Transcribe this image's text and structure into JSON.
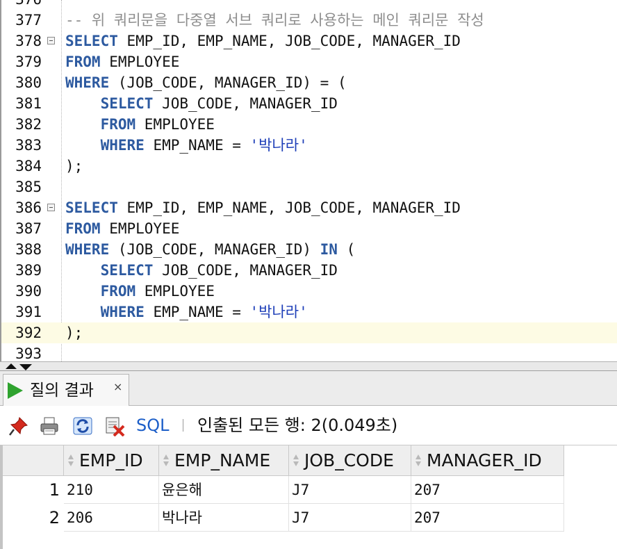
{
  "editor": {
    "lines": [
      {
        "num": "376",
        "segments": []
      },
      {
        "num": "377",
        "segments": [
          {
            "t": "-- 위 쿼리문을 다중열 서브 쿼리로 사용하는 메인 쿼리문 작성",
            "c": "cmt"
          }
        ]
      },
      {
        "num": "378",
        "fold": true,
        "segments": [
          {
            "t": "SELECT",
            "c": "kw"
          },
          {
            "t": " EMP_ID, EMP_NAME, JOB_CODE, MANAGER_ID",
            "c": ""
          }
        ]
      },
      {
        "num": "379",
        "segments": [
          {
            "t": "FROM",
            "c": "kw"
          },
          {
            "t": " EMPLOYEE",
            "c": ""
          }
        ]
      },
      {
        "num": "380",
        "segments": [
          {
            "t": "WHERE",
            "c": "kw"
          },
          {
            "t": " (JOB_CODE, MANAGER_ID) = (",
            "c": ""
          }
        ]
      },
      {
        "num": "381",
        "segments": [
          {
            "t": "    ",
            "c": ""
          },
          {
            "t": "SELECT",
            "c": "kw"
          },
          {
            "t": " JOB_CODE, MANAGER_ID",
            "c": ""
          }
        ]
      },
      {
        "num": "382",
        "segments": [
          {
            "t": "    ",
            "c": ""
          },
          {
            "t": "FROM",
            "c": "kw"
          },
          {
            "t": " EMPLOYEE",
            "c": ""
          }
        ]
      },
      {
        "num": "383",
        "segments": [
          {
            "t": "    ",
            "c": ""
          },
          {
            "t": "WHERE",
            "c": "kw"
          },
          {
            "t": " EMP_NAME = ",
            "c": ""
          },
          {
            "t": "'박나라'",
            "c": "str"
          }
        ]
      },
      {
        "num": "384",
        "segments": [
          {
            "t": ");",
            "c": ""
          }
        ]
      },
      {
        "num": "385",
        "segments": []
      },
      {
        "num": "386",
        "fold": true,
        "segments": [
          {
            "t": "SELECT",
            "c": "kw"
          },
          {
            "t": " EMP_ID, EMP_NAME, JOB_CODE, MANAGER_ID",
            "c": ""
          }
        ]
      },
      {
        "num": "387",
        "segments": [
          {
            "t": "FROM",
            "c": "kw"
          },
          {
            "t": " EMPLOYEE",
            "c": ""
          }
        ]
      },
      {
        "num": "388",
        "segments": [
          {
            "t": "WHERE",
            "c": "kw"
          },
          {
            "t": " (JOB_CODE, MANAGER_ID) ",
            "c": ""
          },
          {
            "t": "IN",
            "c": "kw"
          },
          {
            "t": " (",
            "c": ""
          }
        ]
      },
      {
        "num": "389",
        "segments": [
          {
            "t": "    ",
            "c": ""
          },
          {
            "t": "SELECT",
            "c": "kw"
          },
          {
            "t": " JOB_CODE, MANAGER_ID",
            "c": ""
          }
        ]
      },
      {
        "num": "390",
        "segments": [
          {
            "t": "    ",
            "c": ""
          },
          {
            "t": "FROM",
            "c": "kw"
          },
          {
            "t": " EMPLOYEE",
            "c": ""
          }
        ]
      },
      {
        "num": "391",
        "segments": [
          {
            "t": "    ",
            "c": ""
          },
          {
            "t": "WHERE",
            "c": "kw"
          },
          {
            "t": " EMP_NAME = ",
            "c": ""
          },
          {
            "t": "'박나라'",
            "c": "str"
          }
        ]
      },
      {
        "num": "392",
        "current": true,
        "segments": [
          {
            "t": ");",
            "c": ""
          }
        ]
      },
      {
        "num": "393",
        "segments": []
      }
    ]
  },
  "results_tab": {
    "label": "질의 결과",
    "close": "×"
  },
  "toolbar": {
    "icons": [
      "pin-icon",
      "print-icon",
      "refresh-icon",
      "clear-icon"
    ],
    "sql_label": "SQL",
    "status": "인출된 모든 행: 2(0.049초)"
  },
  "grid": {
    "columns": [
      "EMP_ID",
      "EMP_NAME",
      "JOB_CODE",
      "MANAGER_ID"
    ],
    "rows": [
      {
        "num": "1",
        "cells": [
          "210",
          "윤은해",
          "J7",
          "207"
        ]
      },
      {
        "num": "2",
        "cells": [
          "206",
          "박나라",
          "J7",
          "207"
        ]
      }
    ]
  },
  "colors": {
    "keyword": "#2d5aa0",
    "string": "#1e3fb8",
    "comment": "#8e8e8e",
    "current_line": "#fdfbe4"
  }
}
